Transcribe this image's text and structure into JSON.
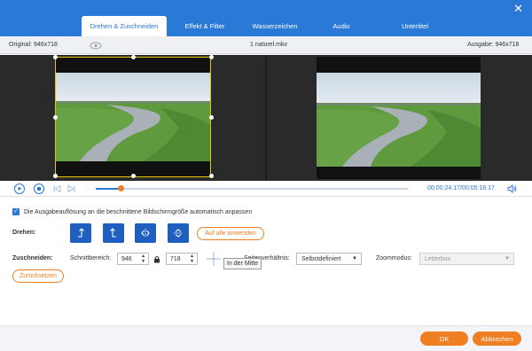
{
  "tabs": [
    {
      "label": "Drehen & Zuschneiden",
      "active": true
    },
    {
      "label": "Effekt & Filter"
    },
    {
      "label": "Wasserzeichen"
    },
    {
      "label": "Audio"
    },
    {
      "label": "Untertitel"
    }
  ],
  "window": {
    "close_glyph": "✕"
  },
  "info": {
    "original": "Original: 946x718",
    "filename": "1 naturel.mkv",
    "output": "Ausgabe: 946x718"
  },
  "player": {
    "timecode": "00:00:24.17/00:05:18.17",
    "progress": 0.08
  },
  "options": {
    "checkbox_label": "Die Ausgabeauflösung an die beschnittene Bildschirmgröße automatisch anpassen",
    "checkbox_checked": true
  },
  "rotate": {
    "label": "Drehen:",
    "apply_all": "Auf alle anwenden"
  },
  "crop": {
    "label": "Zuschneiden:",
    "area_label": "Schnittbereich:",
    "width": "946",
    "height": "718",
    "aspect_label": "Seitenverhältnis:",
    "aspect_value": "Selbstdefiniert",
    "zoom_label": "Zoommodus:",
    "zoom_value": "Letterbox",
    "reset": "Zurücksetzen",
    "tooltip": "In der Mitte"
  },
  "footer": {
    "ok": "OK",
    "cancel": "Abbrechen"
  },
  "colors": {
    "accent": "#2b79d6",
    "orange": "#f07f24"
  }
}
